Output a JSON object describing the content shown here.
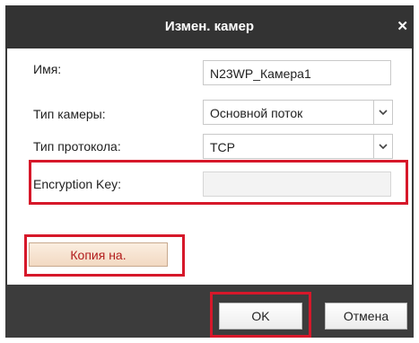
{
  "dialog": {
    "title": "Измен. камер",
    "close_icon": "close-icon"
  },
  "form": {
    "name_label": "Имя:",
    "name_value": "N23WP_Камера1",
    "camera_type_label": "Тип камеры:",
    "camera_type_value": "Основной поток",
    "protocol_type_label": "Тип протокола:",
    "protocol_type_value": "TCP",
    "encryption_key_label": "Encryption Key:",
    "encryption_key_value": ""
  },
  "buttons": {
    "copy_label": "Копия на.",
    "ok_label": "OK",
    "cancel_label": "Отмена"
  },
  "colors": {
    "highlight": "#d6182a",
    "titlebar": "#333333",
    "copy_text": "#b21c1c"
  }
}
